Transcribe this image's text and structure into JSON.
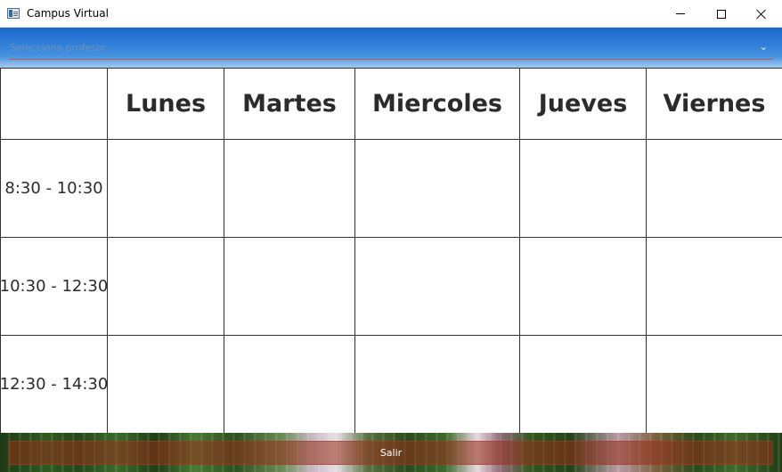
{
  "window": {
    "title": "Campus Virtual",
    "icon": "app-window-icon",
    "controls": [
      "minimize-icon",
      "maximize-icon",
      "close-icon"
    ]
  },
  "selector": {
    "placeholder": "Selecciona profesor",
    "arrow_icon": "chevron-down-icon",
    "underline_color": "#c0392b"
  },
  "schedule": {
    "days": [
      "Lunes",
      "Martes",
      "Miercoles",
      "Jueves",
      "Viernes"
    ],
    "time_slots": [
      "8:30 - 10:30",
      "10:30 - 12:30",
      "12:30 - 14:30"
    ],
    "cells": [
      [
        "",
        "",
        "",
        "",
        ""
      ],
      [
        "",
        "",
        "",
        "",
        ""
      ],
      [
        "",
        "",
        "",
        "",
        ""
      ]
    ]
  },
  "footer": {
    "exit_label": "Salir",
    "exit_color": "#962d19"
  }
}
